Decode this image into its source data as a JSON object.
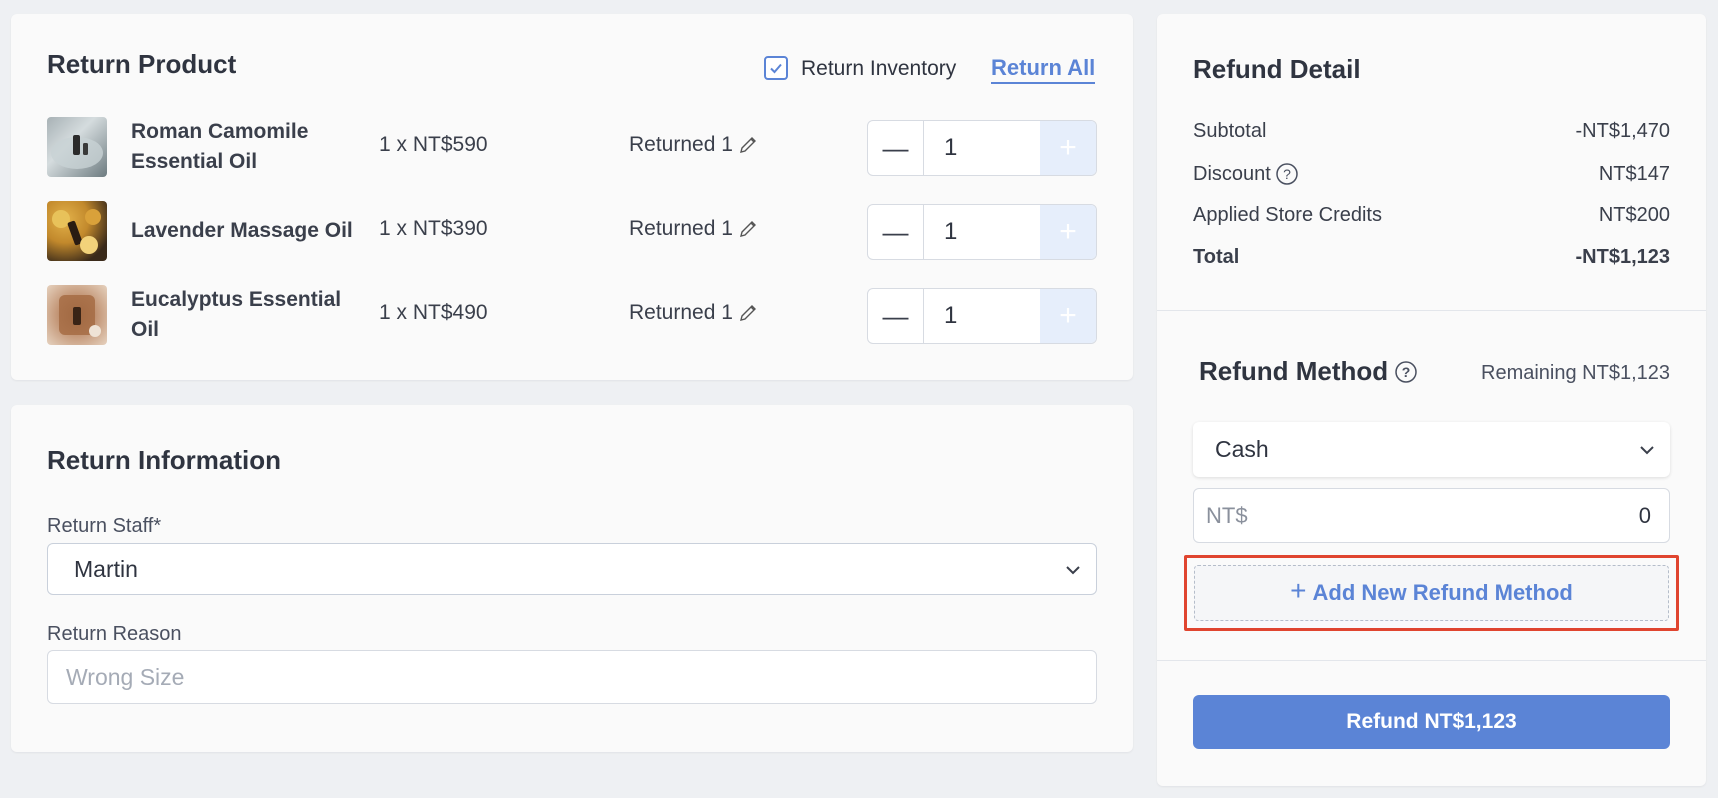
{
  "return_product": {
    "title": "Return Product",
    "return_inventory_label": "Return Inventory",
    "return_inventory_checked": true,
    "return_all_label": "Return All",
    "items": [
      {
        "name": "Roman Camomile Essential Oil",
        "price": "1 x NT$590",
        "returned": "Returned 1",
        "quantity": "1",
        "minus": "—",
        "plus": "+"
      },
      {
        "name": "Lavender Massage Oil",
        "price": "1 x NT$390",
        "returned": "Returned 1",
        "quantity": "1",
        "minus": "—",
        "plus": "+"
      },
      {
        "name": "Eucalyptus Essential Oil",
        "price": "1 x NT$490",
        "returned": "Returned 1",
        "quantity": "1",
        "minus": "—",
        "plus": "+"
      }
    ]
  },
  "return_information": {
    "title": "Return Information",
    "staff_label": "Return Staff*",
    "staff_value": "Martin",
    "reason_label": "Return Reason",
    "reason_placeholder": "Wrong Size"
  },
  "refund_detail": {
    "title": "Refund Detail",
    "subtotal_label": "Subtotal",
    "subtotal_value": "-NT$1,470",
    "discount_label": "Discount",
    "discount_value": "NT$147",
    "store_credits_label": "Applied Store Credits",
    "store_credits_value": "NT$200",
    "total_label": "Total",
    "total_value": "-NT$1,123"
  },
  "refund_method": {
    "title": "Refund Method",
    "remaining": "Remaining NT$1,123",
    "method_value": "Cash",
    "amount_prefix": "NT$",
    "amount_value": "0",
    "add_label": "Add New Refund Method",
    "add_icon": "+",
    "refund_button": "Refund NT$1,123"
  },
  "colors": {
    "accent": "#5b84d6",
    "highlight": "#e0452f"
  }
}
